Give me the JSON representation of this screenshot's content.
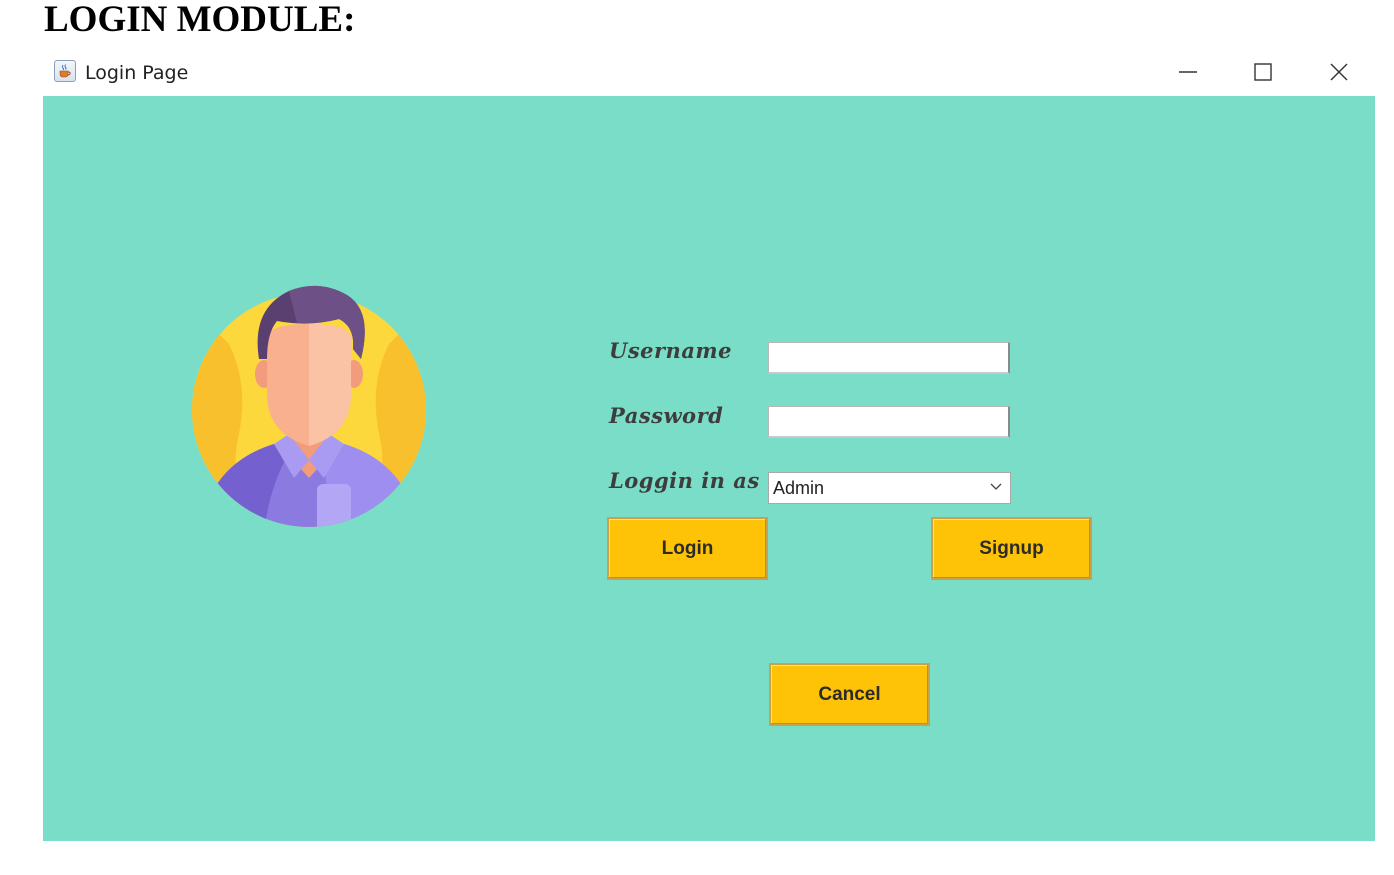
{
  "document": {
    "heading": "LOGIN MODULE:"
  },
  "window": {
    "title": "Login Page",
    "app_icon": "java-cup-icon",
    "controls": [
      "minimize-icon",
      "maximize-icon",
      "close-icon"
    ]
  },
  "form": {
    "username_label": "Username",
    "password_label": "Password",
    "role_label": "Loggin in as",
    "username_value": "",
    "password_value": "",
    "role_selected": "Admin"
  },
  "buttons": {
    "login": "Login",
    "signup": "Signup",
    "cancel": "Cancel"
  },
  "colors": {
    "client_background": "#79ddc8",
    "button_fill": "#fec206",
    "avatar_circle": "#fcd83c",
    "avatar_shirt": "#8b7be0",
    "avatar_hair": "#5a4070",
    "avatar_skin": "#f8b08f"
  }
}
